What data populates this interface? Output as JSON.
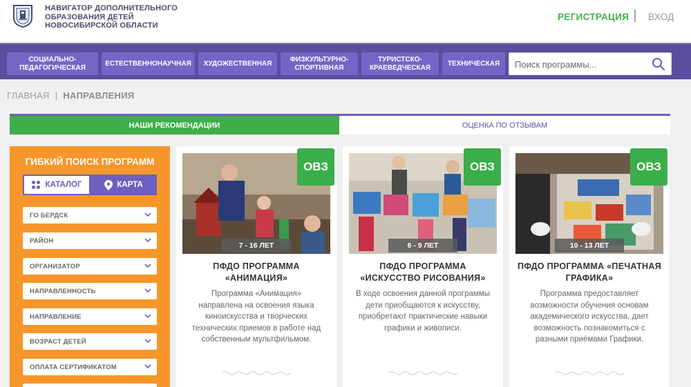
{
  "header": {
    "brand_lines": [
      "НАВИГАТОР ДОПОЛНИТЕЛЬНОГО",
      "ОБРАЗОВАНИЯ ДЕТЕЙ",
      "НОВОСИБИРСКОЙ ОБЛАСТИ"
    ],
    "register_label": "РЕГИСТРАЦИЯ",
    "login_label": "ВХОД"
  },
  "nav": {
    "items": [
      {
        "label": "СОЦИАЛЬНО-\nПЕДАГОГИЧЕСКАЯ"
      },
      {
        "label": "ЕСТЕСТВЕННОНАУЧНАЯ"
      },
      {
        "label": "ХУДОЖЕСТВЕННАЯ"
      },
      {
        "label": "ФИЗКУЛЬТУРНО-\nСПОРТИВНАЯ"
      },
      {
        "label": "ТУРИСТСКО-\nКРАЕВЕДЧЕСКАЯ"
      },
      {
        "label": "ТЕХНИЧЕСКАЯ"
      }
    ],
    "search_placeholder": "Поиск программы..."
  },
  "breadcrumb": {
    "home": "ГЛАВНАЯ",
    "separator": "|",
    "current": "НАПРАВЛЕНИЯ"
  },
  "tabs": {
    "recommendations": "НАШИ РЕКОМЕНДАЦИИ",
    "reviews": "ОЦЕНКА ПО ОТЗЫВАМ"
  },
  "sidebar": {
    "title": "ГИБКИЙ ПОИСК ПРОГРАММ",
    "catalog_label": "КАТАЛОГ",
    "map_label": "КАРТА",
    "filters": [
      "ГО БЕРДСК",
      "РАЙОН",
      "ОРГАНИЗАТОР",
      "НАПРАВЛЕННОСТЬ",
      "НАПРАВЛЕНИЕ",
      "ВОЗРАСТ ДЕТЕЙ",
      "ОПЛАТА СЕРТИФИКАТОМ",
      ""
    ]
  },
  "cards": [
    {
      "badge": "ОВЗ",
      "age": "7 - 16 ЛЕТ",
      "title_lines": [
        "ПФДО ПРОГРАММА",
        "«АНИМАЦИЯ»"
      ],
      "desc_lines": [
        "Программа «Анимация»",
        "направлена на освоения языка",
        "киноискусства и творческих",
        "технических приемов в работе над",
        "собственным мультфильмом."
      ]
    },
    {
      "badge": "ОВЗ",
      "age": "6 - 9 ЛЕТ",
      "title_lines": [
        "ПФДО ПРОГРАММА",
        "«ИСКУССТВО РИСОВАНИЯ»"
      ],
      "desc_lines": [
        "В ходе освоения данной программы",
        "дети приобщаются к искусству,",
        "приобретают практические навыки",
        "графики и живописи."
      ]
    },
    {
      "badge": "ОВЗ",
      "age": "10 - 13 ЛЕТ",
      "title_lines": [
        "ПФДО ПРОГРАММА «ПЕЧАТНАЯ",
        "ГРАФИКА»"
      ],
      "desc_lines": [
        "Программа предоставляет",
        "возможности обучения основам",
        "академического искусства, дает",
        "возможность познакомиться с",
        "разными приёмами Графики."
      ]
    }
  ],
  "colors": {
    "accent_purple": "#5a4e9e",
    "nav_item": "#7366c6",
    "green": "#3fae49",
    "orange": "#f7962a"
  }
}
